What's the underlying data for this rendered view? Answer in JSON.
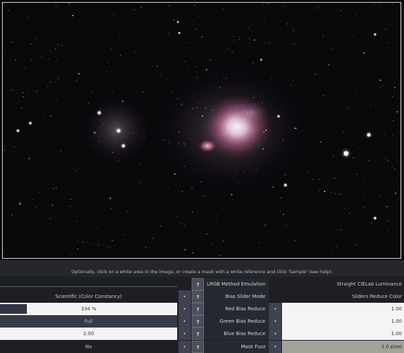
{
  "hint_text": "Optionally, click on a white area in the image, or create a mask with a white reference and click 'Sample' (see help).",
  "rows": [
    {
      "label": "LRGB Method Emulation",
      "left_value": "",
      "right_value": "Straight CIELab Luminance"
    },
    {
      "label": "Bias Slider Mode",
      "left_value": "Scientific (Color Constancy)",
      "right_value": "Sliders Reduce Color"
    },
    {
      "label": "Red Bias Reduce",
      "left_value": "334 %",
      "right_value": "1.00"
    },
    {
      "label": "Green Bias Reduce",
      "left_value": "Full",
      "right_value": "1.00"
    },
    {
      "label": "Blue Bias Reduce",
      "left_value": "2.00",
      "right_value": "1.00"
    },
    {
      "label": "Mask Fuzz",
      "left_value": "No",
      "right_value": "1.0 pixel"
    }
  ],
  "help_glyph": "?",
  "arrow_glyph": "▸",
  "left_arrow_glyph": "◂",
  "icons": {
    "help": "help-icon",
    "arrow": "chevron-right-icon",
    "left-arrow": "chevron-left-icon"
  },
  "colors": {
    "panel": "#1d1f24",
    "field_white": "#f4f4f4",
    "field_dark": "#363a48",
    "slider_fill": "#2f3446"
  },
  "slider": {
    "red_bias_fill_fraction": 0.15
  }
}
